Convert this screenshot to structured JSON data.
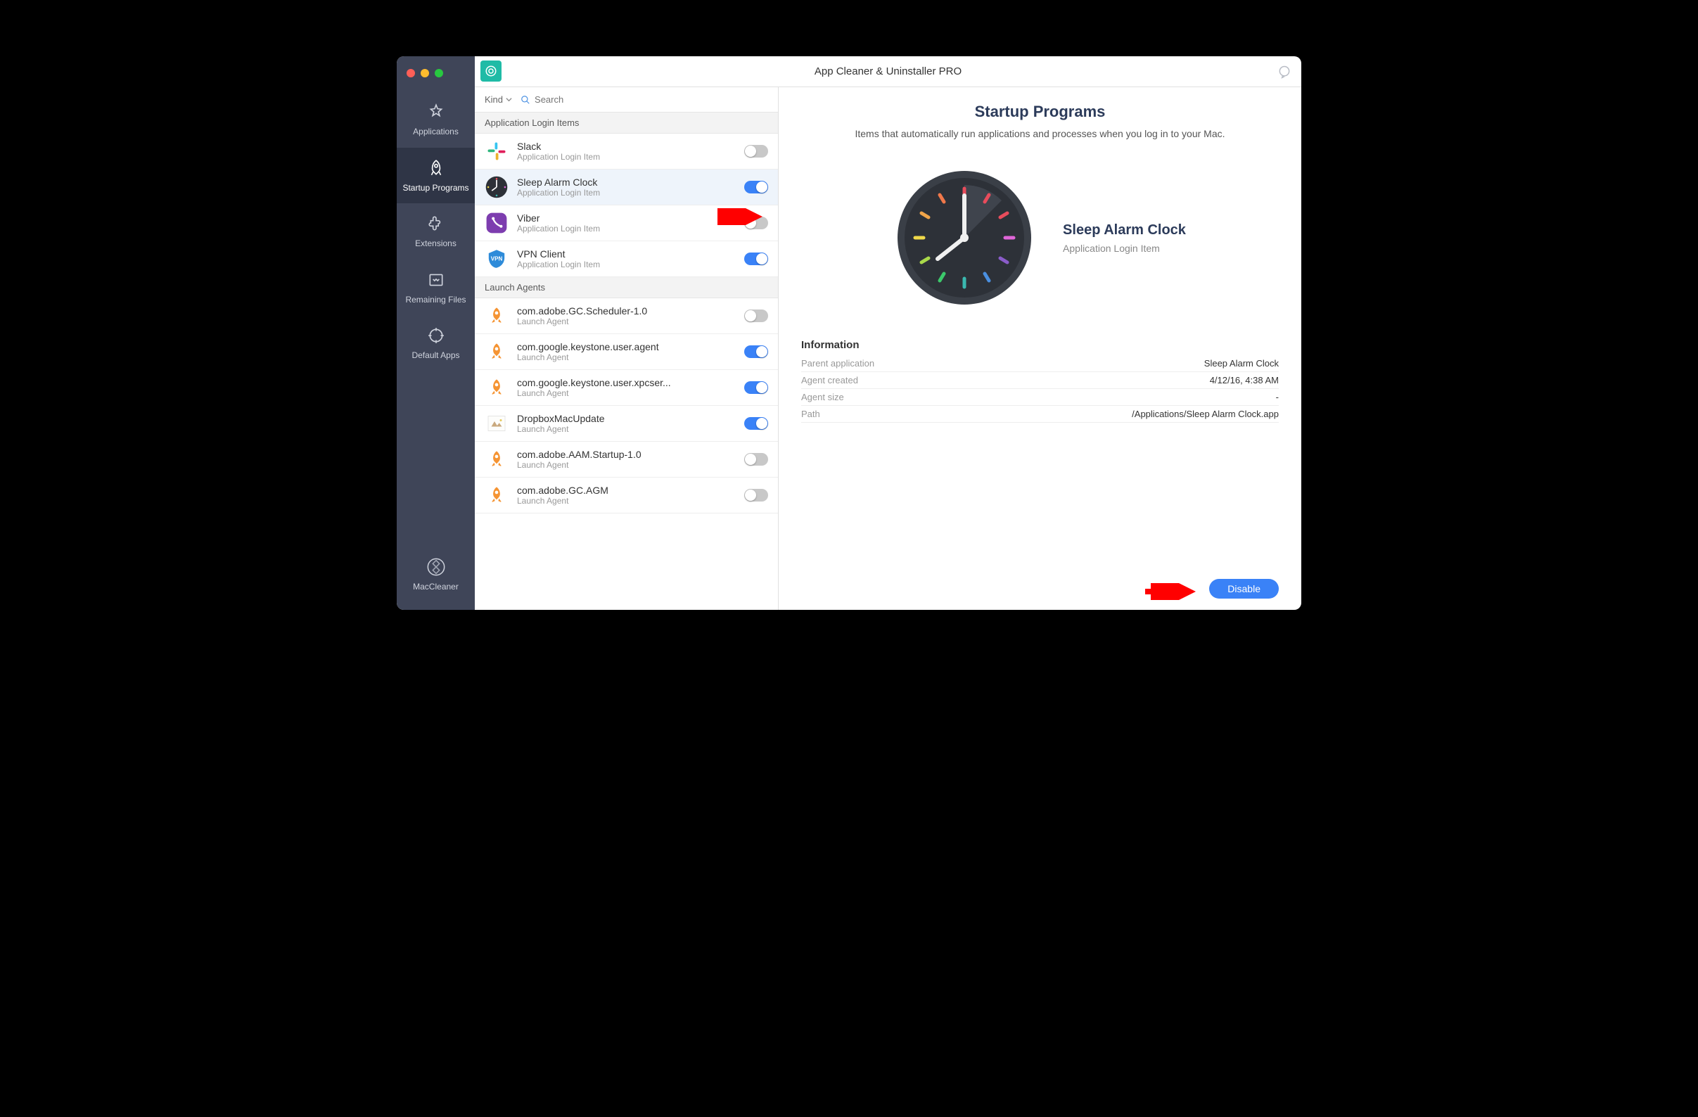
{
  "window": {
    "title": "App Cleaner & Uninstaller PRO"
  },
  "sidebar": {
    "items": [
      {
        "label": "Applications"
      },
      {
        "label": "Startup Programs"
      },
      {
        "label": "Extensions"
      },
      {
        "label": "Remaining Files"
      },
      {
        "label": "Default Apps"
      }
    ],
    "bottom": {
      "label": "MacCleaner"
    }
  },
  "filter": {
    "kind_label": "Kind",
    "search_placeholder": "Search"
  },
  "sections": {
    "login_items_header": "Application Login Items",
    "launch_agents_header": "Launch Agents"
  },
  "login_items": [
    {
      "name": "Slack",
      "sub": "Application Login Item",
      "on": false,
      "icon": "slack"
    },
    {
      "name": "Sleep Alarm Clock",
      "sub": "Application Login Item",
      "on": true,
      "icon": "clock",
      "selected": true
    },
    {
      "name": "Viber",
      "sub": "Application Login Item",
      "on": false,
      "icon": "viber"
    },
    {
      "name": "VPN Client",
      "sub": "Application Login Item",
      "on": true,
      "icon": "vpn"
    }
  ],
  "launch_agents": [
    {
      "name": "com.adobe.GC.Scheduler-1.0",
      "sub": "Launch Agent",
      "on": false,
      "icon": "rocket"
    },
    {
      "name": "com.google.keystone.user.agent",
      "sub": "Launch Agent",
      "on": true,
      "icon": "rocket"
    },
    {
      "name": "com.google.keystone.user.xpcser...",
      "sub": "Launch Agent",
      "on": true,
      "icon": "rocket"
    },
    {
      "name": "DropboxMacUpdate",
      "sub": "Launch Agent",
      "on": true,
      "icon": "dropbox"
    },
    {
      "name": "com.adobe.AAM.Startup-1.0",
      "sub": "Launch Agent",
      "on": false,
      "icon": "rocket"
    },
    {
      "name": "com.adobe.GC.AGM",
      "sub": "Launch Agent",
      "on": false,
      "icon": "rocket"
    }
  ],
  "detail": {
    "title": "Startup Programs",
    "subtitle": "Items that automatically run applications and processes when you log in to your Mac.",
    "item_name": "Sleep Alarm Clock",
    "item_type": "Application Login Item",
    "info_heading": "Information",
    "rows": [
      {
        "k": "Parent application",
        "v": "Sleep Alarm Clock"
      },
      {
        "k": "Agent created",
        "v": "4/12/16, 4:38 AM"
      },
      {
        "k": "Agent size",
        "v": "-"
      },
      {
        "k": "Path",
        "v": "/Applications/Sleep Alarm Clock.app"
      }
    ],
    "disable_label": "Disable"
  }
}
